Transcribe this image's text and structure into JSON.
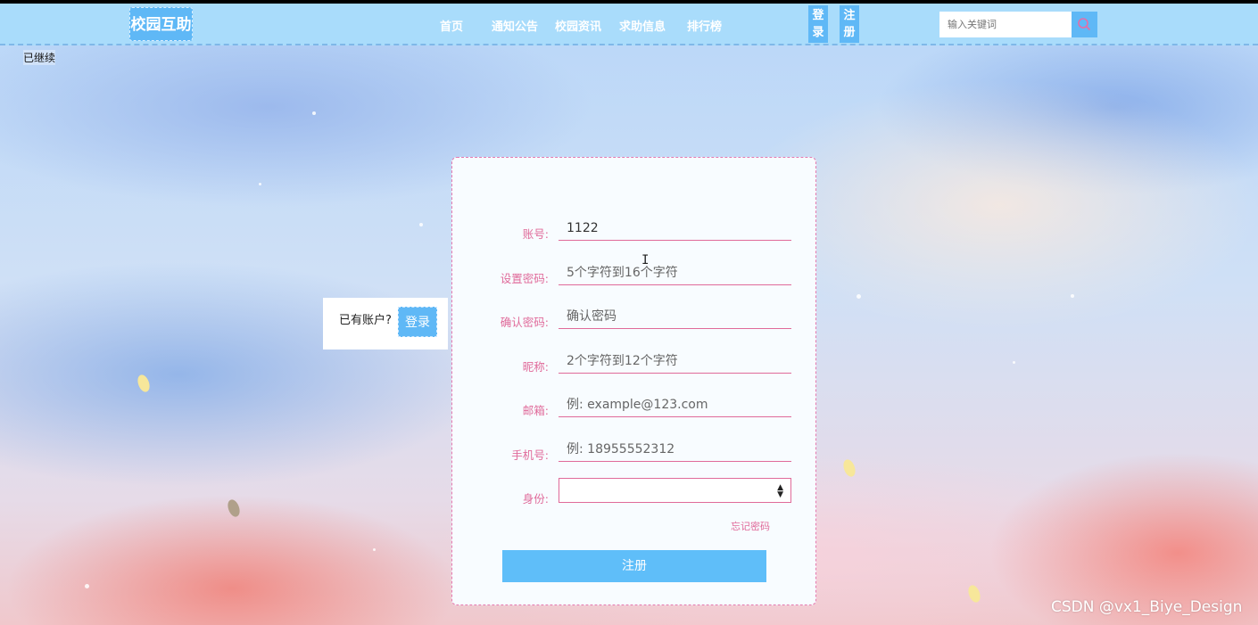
{
  "header": {
    "logo": "校园互助",
    "nav": [
      "首页",
      "通知公告",
      "校园资讯",
      "求助信息",
      "排行榜"
    ],
    "login_label": "登录",
    "login_chars": [
      "登",
      "录"
    ],
    "register_label": "注册",
    "register_chars": [
      "注",
      "册"
    ],
    "search": {
      "placeholder": "输入关键词",
      "value": ""
    }
  },
  "status_text": "已继续",
  "side_panel": {
    "text": "已有账户?",
    "login_button": "登录"
  },
  "form": {
    "fields": [
      {
        "label": "账号:",
        "value": "1122",
        "placeholder": ""
      },
      {
        "label": "设置密码:",
        "value": "",
        "placeholder": "5个字符到16个字符"
      },
      {
        "label": "确认密码:",
        "value": "",
        "placeholder": "确认密码"
      },
      {
        "label": "昵称:",
        "value": "",
        "placeholder": "2个字符到12个字符"
      },
      {
        "label": "邮箱:",
        "value": "",
        "placeholder": "例: example@123.com"
      },
      {
        "label": "手机号:",
        "value": "",
        "placeholder": "例: 18955552312"
      }
    ],
    "identity_label": "身份:",
    "identity_value": "",
    "forgot_password": "忘记密码",
    "submit": "注册"
  },
  "watermark": "CSDN @vx1_Biye_Design",
  "colors": {
    "accent": "#5fb8f6",
    "header_bg": "#a9dcfb",
    "form_pink": "#e06a9a"
  }
}
